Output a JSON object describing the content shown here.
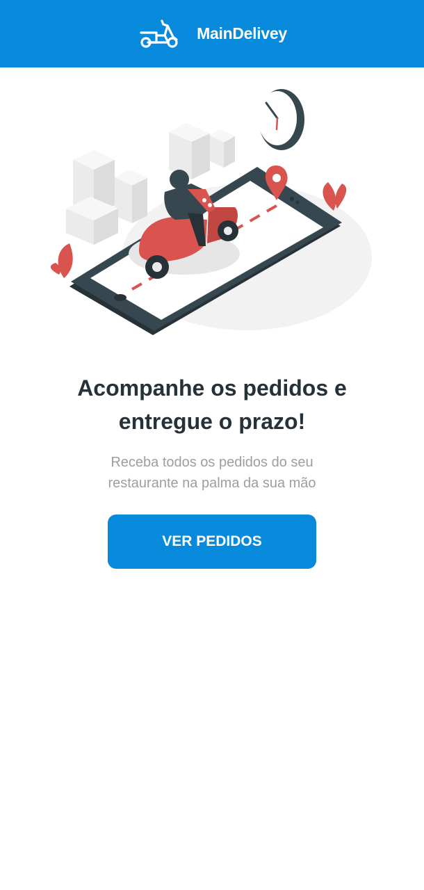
{
  "header": {
    "logo_icon": "scooter-icon",
    "app_name": "MainDelivey",
    "background_color": "#078adc"
  },
  "hero": {
    "illustration": "delivery-scooter-on-phone-illustration"
  },
  "onboarding": {
    "title": "Acompanhe os pedidos e entregue o prazo!",
    "subtitle": "Receba todos os pedidos do seu restaurante na palma da sua mão",
    "button_label": "VER PEDIDOS"
  },
  "colors": {
    "accent": "#078adc",
    "title": "#263238",
    "subtitle": "#9e9e9e",
    "illustration_red": "#d9534f"
  }
}
